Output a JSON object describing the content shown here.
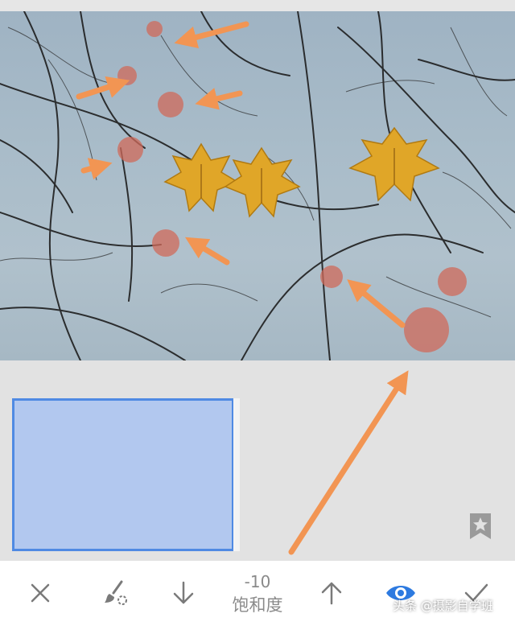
{
  "photo": {
    "description_icon": "maple-leaves-branches-photo"
  },
  "colors": {
    "accent": "#4f8ae3",
    "mask_fill": "#b2c8ef",
    "annotation_arrow": "#f29553",
    "toolbar_icon": "#7a7a7a"
  },
  "toolbar": {
    "cancel_icon": "close-icon",
    "brush_icon": "brush-icon",
    "decrease_icon": "arrow-down-icon",
    "adjustment_value": "-10",
    "adjustment_label": "饱和度",
    "increase_icon": "arrow-up-icon",
    "mask_visibility_icon": "eye-icon",
    "apply_icon": "checkmark-icon"
  },
  "watermark": {
    "text": "头条 @摄影自学班"
  },
  "bookmark_icon": "bookmark-star-icon"
}
